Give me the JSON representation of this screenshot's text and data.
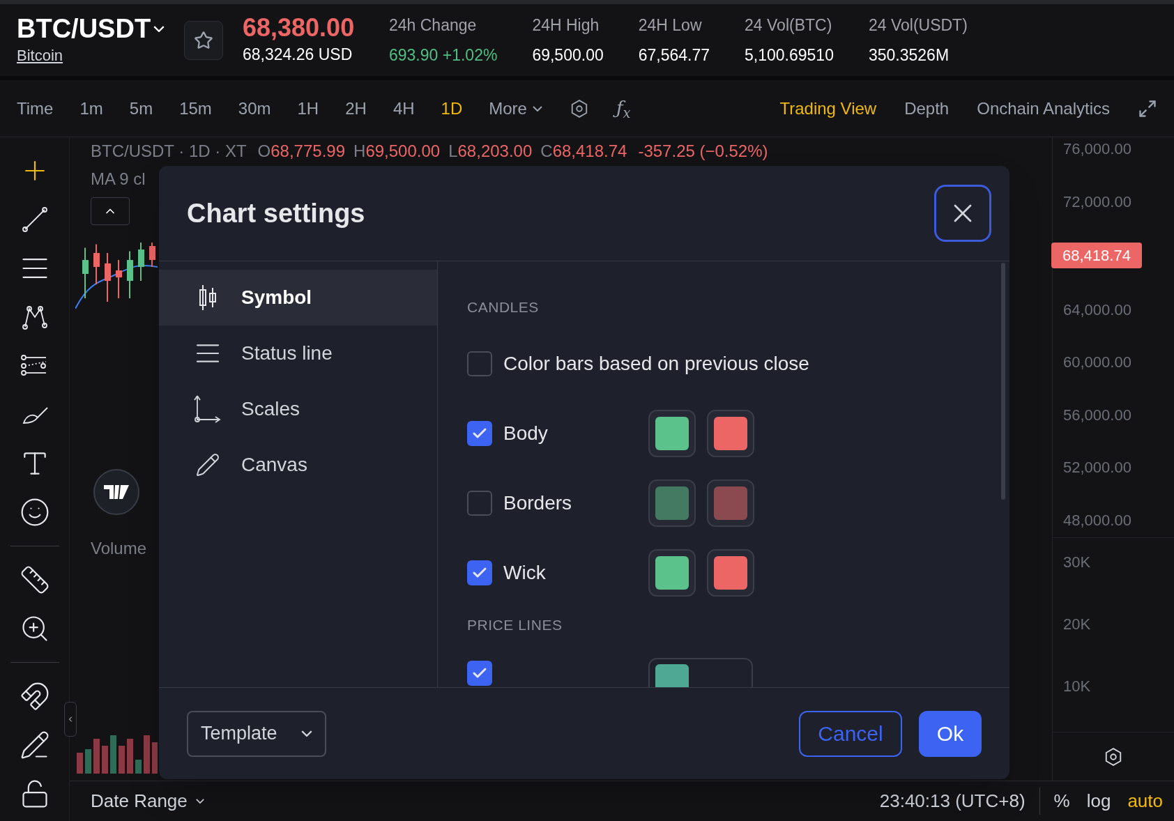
{
  "ticker": {
    "symbol": "BTC/USDT",
    "name": "Bitcoin",
    "favorite": false,
    "price": "68,380.00",
    "price_usd": "68,324.26 USD"
  },
  "stats": [
    {
      "label": "24h Change",
      "value": "693.90 +1.02%",
      "color": "#4fbf83"
    },
    {
      "label": "24H High",
      "value": "69,500.00",
      "color": "#ffffff"
    },
    {
      "label": "24H Low",
      "value": "67,564.77",
      "color": "#ffffff"
    },
    {
      "label": "24 Vol(BTC)",
      "value": "5,100.69510",
      "color": "#ffffff"
    },
    {
      "label": "24 Vol(USDT)",
      "value": "350.3526M",
      "color": "#ffffff"
    }
  ],
  "intervals": [
    {
      "label": "Time",
      "selected": false
    },
    {
      "label": "1m",
      "selected": false
    },
    {
      "label": "5m",
      "selected": false
    },
    {
      "label": "15m",
      "selected": false
    },
    {
      "label": "30m",
      "selected": false
    },
    {
      "label": "1H",
      "selected": false
    },
    {
      "label": "2H",
      "selected": false
    },
    {
      "label": "4H",
      "selected": false
    },
    {
      "label": "1D",
      "selected": true
    }
  ],
  "more": "More",
  "function_symbol": "ƒ$_{x}$",
  "views": [
    {
      "label": "Trading View",
      "selected": true
    },
    {
      "label": "Depth",
      "selected": false
    },
    {
      "label": "Onchain Analytics",
      "selected": false
    }
  ],
  "legend": {
    "symbol": "BTC/USDT · 1D · XT",
    "ohlc": [
      {
        "label": "O",
        "value": "68,775.99"
      },
      {
        "label": "H",
        "value": "69,500.00"
      },
      {
        "label": "L",
        "value": "68,203.00"
      },
      {
        "label": "C",
        "value": "68,418.74"
      }
    ],
    "change": "-357.25 (−0.52%)",
    "indicator": "MA 9 cl"
  },
  "volume_label": "Volume",
  "price_axis": [
    {
      "kind": "tick",
      "label": "76,000.00"
    },
    {
      "kind": "tick",
      "label": "72,000.00"
    },
    {
      "kind": "last",
      "label": "68,418.74"
    },
    {
      "kind": "tick",
      "label": "64,000.00"
    },
    {
      "kind": "tick",
      "label": "60,000.00"
    },
    {
      "kind": "tick",
      "label": "56,000.00"
    },
    {
      "kind": "tick",
      "label": "52,000.00"
    },
    {
      "kind": "tick",
      "label": "48,000.00"
    }
  ],
  "volume_axis": [
    "30K",
    "20K",
    "10K"
  ],
  "bottom_bar": {
    "date_range": "Date Range",
    "time": "23:40:13 (UTC+8)",
    "scales": [
      {
        "label": "%",
        "selected": false
      },
      {
        "label": "log",
        "selected": false
      },
      {
        "label": "auto",
        "selected": true
      }
    ]
  },
  "dialog": {
    "title": "Chart settings",
    "nav": [
      {
        "label": "Symbol",
        "selected": true
      },
      {
        "label": "Status line",
        "selected": false
      },
      {
        "label": "Scales",
        "selected": false
      },
      {
        "label": "Canvas",
        "selected": false
      }
    ],
    "sections": [
      {
        "title": "CANDLES",
        "rows": [
          {
            "label": "Color bars based on previous close",
            "checked": false,
            "swatches": []
          },
          {
            "label": "Body",
            "checked": true,
            "swatches": [
              {
                "color": "#5bc28b"
              },
              {
                "color": "#ec6666"
              }
            ]
          },
          {
            "label": "Borders",
            "checked": false,
            "swatches": [
              {
                "color": "#447a62"
              },
              {
                "color": "#8b4a4f"
              }
            ]
          },
          {
            "label": "Wick",
            "checked": true,
            "swatches": [
              {
                "color": "#5bc28b"
              },
              {
                "color": "#ec6666"
              }
            ]
          }
        ]
      },
      {
        "title": "PRICE LINES",
        "rows": [
          {
            "checked": true,
            "swatches": [
              {
                "color": "#4ea894"
              }
            ]
          }
        ]
      }
    ],
    "template": "Template",
    "cancel": "Cancel",
    "ok": "Ok"
  }
}
